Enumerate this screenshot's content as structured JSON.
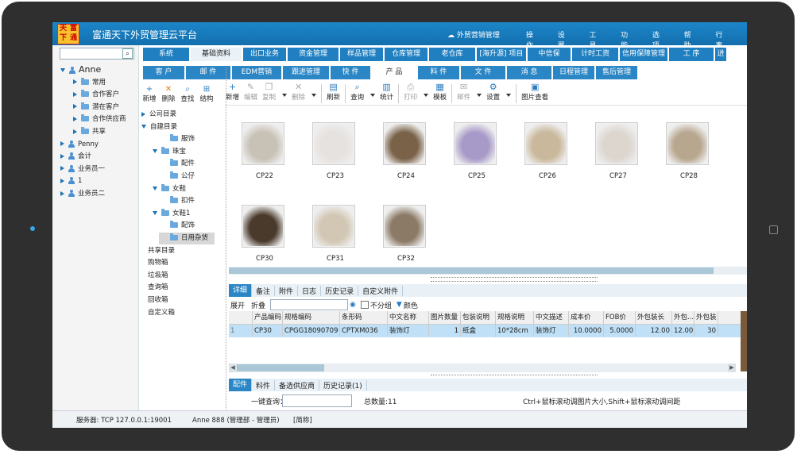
{
  "app": {
    "title": "富通天下外贸管理云平台",
    "logo_chars": [
      "天",
      "富",
      "下",
      "通"
    ],
    "cloud_link": "外贸营销管理",
    "top_menu": [
      "操作",
      "设置",
      "工具",
      "功能",
      "选项",
      "帮助",
      "行事"
    ]
  },
  "left_tree": {
    "items": [
      {
        "label": "Anne",
        "level": 0,
        "expanded": true,
        "icon": "person-icon"
      },
      {
        "label": "常用",
        "level": 1,
        "expanded": false,
        "icon": "folder-icon"
      },
      {
        "label": "合作客户",
        "level": 1,
        "expanded": false,
        "icon": "folder-icon"
      },
      {
        "label": "潜在客户",
        "level": 1,
        "expanded": false,
        "icon": "folder-icon"
      },
      {
        "label": "合作供应商",
        "level": 1,
        "expanded": false,
        "icon": "folder-icon"
      },
      {
        "label": "共享",
        "level": 1,
        "expanded": false,
        "icon": "folder-icon"
      },
      {
        "label": "Penny",
        "level": 0,
        "expanded": false,
        "icon": "person-icon"
      },
      {
        "label": "会计",
        "level": 0,
        "expanded": false,
        "icon": "person-icon"
      },
      {
        "label": "业务员一",
        "level": 0,
        "expanded": false,
        "icon": "person-icon"
      },
      {
        "label": "1",
        "level": 0,
        "expanded": false,
        "icon": "person-icon"
      },
      {
        "label": "业务员二",
        "level": 0,
        "expanded": false,
        "icon": "person-icon"
      }
    ]
  },
  "tree2": {
    "tools": [
      {
        "label": "新增",
        "icon": "plus-icon"
      },
      {
        "label": "删除",
        "icon": "x-icon"
      },
      {
        "label": "查找",
        "icon": "find-icon"
      },
      {
        "label": "结构",
        "icon": "structure-icon"
      }
    ],
    "items": [
      {
        "label": "公司目录",
        "level": 0,
        "arrow": "right",
        "folder": false
      },
      {
        "label": "自建目录",
        "level": 0,
        "arrow": "down",
        "folder": false
      },
      {
        "label": "服饰",
        "level": 2,
        "arrow": "none",
        "folder": true
      },
      {
        "label": "珠宝",
        "level": 1,
        "arrow": "down",
        "folder": true
      },
      {
        "label": "配件",
        "level": 2,
        "arrow": "none",
        "folder": true
      },
      {
        "label": "公仔",
        "level": 2,
        "arrow": "none",
        "folder": true
      },
      {
        "label": "女鞋",
        "level": 1,
        "arrow": "down",
        "folder": true
      },
      {
        "label": "扣件",
        "level": 2,
        "arrow": "none",
        "folder": true
      },
      {
        "label": "女鞋1",
        "level": 1,
        "arrow": "down",
        "folder": true
      },
      {
        "label": "配饰",
        "level": 2,
        "arrow": "none",
        "folder": true
      },
      {
        "label": "日用杂货",
        "level": 2,
        "arrow": "none",
        "folder": true,
        "selected": true
      },
      {
        "label": "共享目录",
        "level": 0,
        "arrow": "none",
        "folder": false
      },
      {
        "label": "购物箱",
        "level": 0,
        "arrow": "none",
        "folder": false
      },
      {
        "label": "垃圾箱",
        "level": 0,
        "arrow": "none",
        "folder": false
      },
      {
        "label": "查询箱",
        "level": 0,
        "arrow": "none",
        "folder": false
      },
      {
        "label": "回收箱",
        "level": 0,
        "arrow": "none",
        "folder": false
      },
      {
        "label": "自定义箱",
        "level": 0,
        "arrow": "none",
        "folder": false
      }
    ]
  },
  "tabs_row1": [
    {
      "label": "系统",
      "active": false
    },
    {
      "label": "基础资料",
      "active": true
    },
    {
      "label": "出口业务",
      "active": false
    },
    {
      "label": "资金管理",
      "active": false
    },
    {
      "label": "样品管理",
      "active": false
    },
    {
      "label": "仓库管理",
      "active": false
    },
    {
      "label": "老仓库",
      "active": false
    },
    {
      "label": "[海升源] 项目",
      "active": false
    },
    {
      "label": "中信保",
      "active": false
    },
    {
      "label": "计时工资",
      "active": false
    },
    {
      "label": "信用保障管理",
      "active": false
    },
    {
      "label": "工 序",
      "active": false
    },
    {
      "label": "进",
      "active": false
    }
  ],
  "tabs_row2": [
    {
      "label": "客 户",
      "active": false
    },
    {
      "label": "邮 件",
      "active": false
    },
    {
      "label": "EDM营销",
      "active": false
    },
    {
      "label": "跟进管理",
      "active": false
    },
    {
      "label": "快 件",
      "active": false
    },
    {
      "label": "产 品",
      "active": true
    },
    {
      "label": "料 件",
      "active": false
    },
    {
      "label": "文 件",
      "active": false
    },
    {
      "label": "消 息",
      "active": false
    },
    {
      "label": "日程管理",
      "active": false
    },
    {
      "label": "售后管理",
      "active": false
    }
  ],
  "toolbar": [
    {
      "label": "新增",
      "icon": "plus-icon",
      "disabled": false,
      "dropdown": false
    },
    {
      "label": "编辑",
      "icon": "edit-icon",
      "disabled": true,
      "dropdown": false
    },
    {
      "label": "复制",
      "icon": "copy-icon",
      "disabled": true,
      "dropdown": true
    },
    {
      "label": "删除",
      "icon": "x-icon",
      "disabled": true,
      "dropdown": true
    },
    {
      "label": "刷新",
      "icon": "refresh-icon",
      "disabled": false,
      "dropdown": false
    },
    {
      "label": "查询",
      "icon": "search-icon",
      "disabled": false,
      "dropdown": true
    },
    {
      "label": "统计",
      "icon": "chart-icon",
      "disabled": false,
      "dropdown": false
    },
    {
      "label": "打印",
      "icon": "print-icon",
      "disabled": true,
      "dropdown": true
    },
    {
      "label": "模板",
      "icon": "template-icon",
      "disabled": false,
      "dropdown": false
    },
    {
      "label": "邮件",
      "icon": "mail-icon",
      "disabled": true,
      "dropdown": true
    },
    {
      "label": "设置",
      "icon": "settings-icon",
      "disabled": false,
      "dropdown": true
    },
    {
      "label": "图片查看",
      "icon": "image-icon",
      "disabled": false,
      "dropdown": false
    }
  ],
  "products": [
    {
      "code": "CP22",
      "color": "#c8c1b6"
    },
    {
      "code": "CP23",
      "color": "#e6e2df"
    },
    {
      "code": "CP24",
      "color": "#7a6248"
    },
    {
      "code": "CP25",
      "color": "#a89ac8"
    },
    {
      "code": "CP26",
      "color": "#c9b89c"
    },
    {
      "code": "CP27",
      "color": "#dcd6cf"
    },
    {
      "code": "CP28",
      "color": "#b8a78f"
    },
    {
      "code": "CP30",
      "color": "#4a3a2c"
    },
    {
      "code": "CP31",
      "color": "#d2c7b4"
    },
    {
      "code": "CP32",
      "color": "#8b7a66"
    }
  ],
  "detail_tabs": [
    {
      "label": "详细",
      "active": true
    },
    {
      "label": "备注",
      "active": false
    },
    {
      "label": "附件",
      "active": false
    },
    {
      "label": "日志",
      "active": false
    },
    {
      "label": "历史记录",
      "active": false
    },
    {
      "label": "自定义附件",
      "active": false
    }
  ],
  "detail_bar": {
    "expand": "展开",
    "collapse": "折叠",
    "ungroup": "不分组",
    "color": "颜色"
  },
  "grid": {
    "columns": [
      "",
      "产品编码",
      "规格编码",
      "条形码",
      "中文名称",
      "图片数量",
      "包装说明",
      "规格说明",
      "中文描述",
      "成本价",
      "FOB价",
      "外包装长",
      "外包...",
      "外包装"
    ],
    "rows": [
      [
        "1",
        "CP30",
        "CPGG18090709",
        "CPTXM036",
        "装饰灯",
        "1",
        "纸盒",
        "10*28cm",
        "装饰灯",
        "10.0000",
        "5.0000",
        "12.00",
        "12.00",
        "30"
      ]
    ]
  },
  "bottom_tabs": [
    {
      "label": "配件",
      "active": true
    },
    {
      "label": "料件",
      "active": false
    },
    {
      "label": "备选供应商",
      "active": false
    },
    {
      "label": "历史记录(1)",
      "active": false
    }
  ],
  "query": {
    "label": "一键查询：",
    "total": "总数量:11",
    "hint": "Ctrl+鼠标滚动调图片大小,Shift+鼠标滚动调间距"
  },
  "status": {
    "server": "服务器: TCP   127.0.0.1:19001",
    "user": "Anne 888 (管理部 - 管理员)",
    "lang": "[简称]"
  },
  "colors": {
    "accent": "#1f7fc0",
    "title_bar": "#1877ba",
    "selected_row": "#bfe0f6"
  }
}
